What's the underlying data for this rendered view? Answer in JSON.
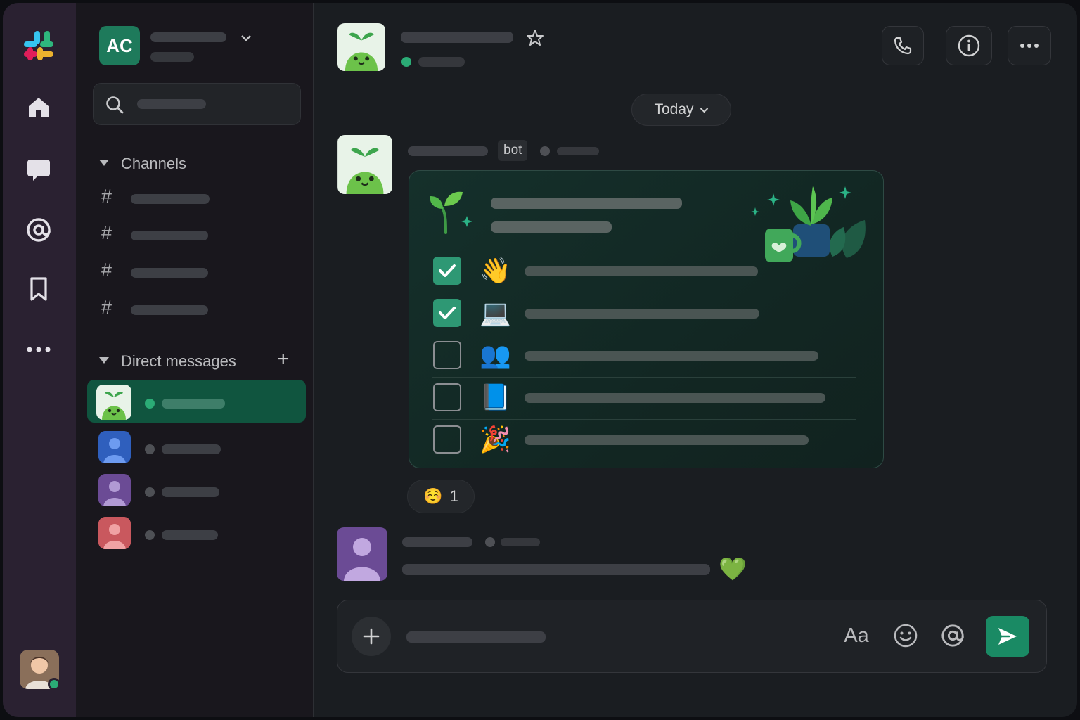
{
  "workspace": {
    "initials": "AC"
  },
  "sidebar": {
    "channels_label": "Channels",
    "channels_hash": "#",
    "dm_label": "Direct messages",
    "add_dm": "+"
  },
  "main": {
    "date_divider": "Today",
    "bot_tag": "bot",
    "tasks": [
      {
        "checked": true,
        "emoji": "👋"
      },
      {
        "checked": true,
        "emoji": "💻"
      },
      {
        "checked": false,
        "emoji": "👥"
      },
      {
        "checked": false,
        "emoji": "📘"
      },
      {
        "checked": false,
        "emoji": "🎉"
      }
    ],
    "reaction": {
      "emoji": "☺️",
      "count": "1"
    },
    "reply_emoji": "💚"
  },
  "composer": {
    "format_label": "Aa"
  },
  "colors": {
    "accent": "#1a8a64",
    "active_dm": "#10553f",
    "online": "#2bac76",
    "rail": "#2a2131"
  },
  "icons": [
    "slack-logo-icon",
    "home-icon",
    "dms-icon",
    "mentions-icon",
    "bookmark-icon",
    "more-icon",
    "search-icon",
    "phone-icon",
    "info-icon",
    "star-icon",
    "chevron-down-icon",
    "plus-icon",
    "emoji-icon",
    "at-icon",
    "send-icon",
    "checkmark-icon",
    "sprout-icon"
  ]
}
